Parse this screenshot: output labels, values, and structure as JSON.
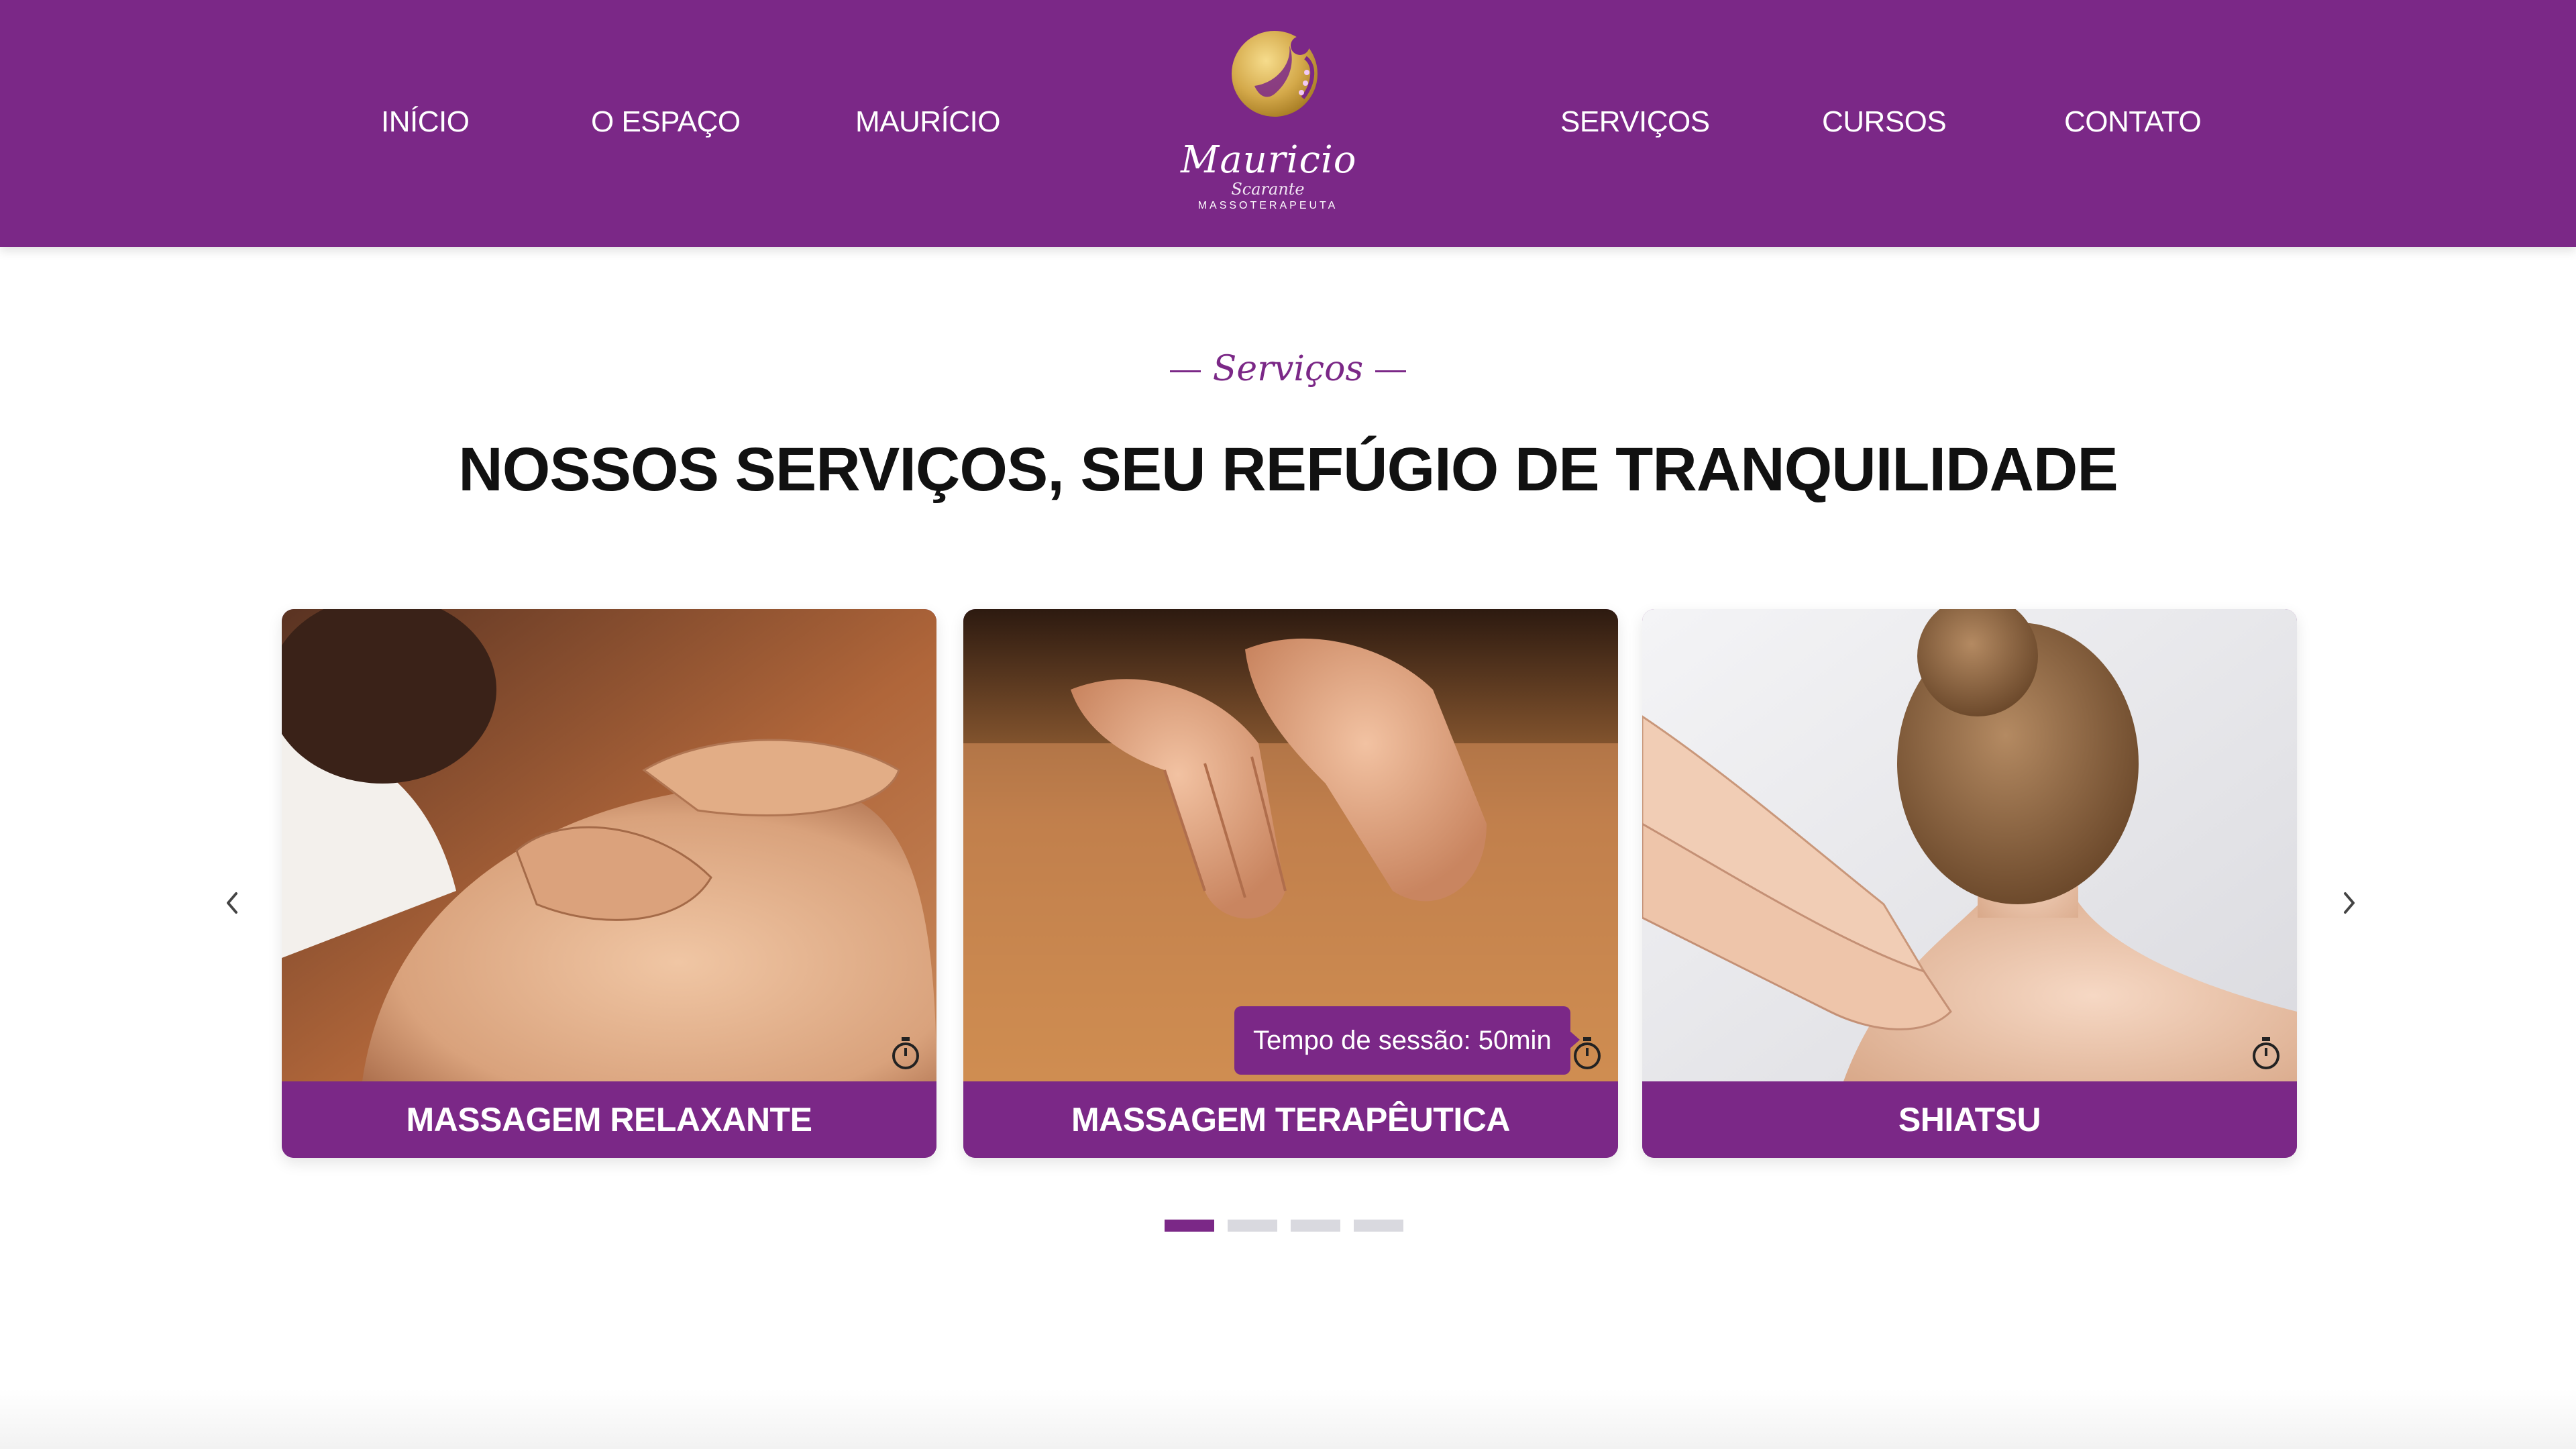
{
  "nav": {
    "items": [
      {
        "label": "INÍCIO"
      },
      {
        "label": "O ESPAÇO"
      },
      {
        "label": "MAURÍCIO"
      },
      {
        "label": "SERVIÇOS"
      },
      {
        "label": "CURSOS"
      },
      {
        "label": "CONTATO"
      }
    ]
  },
  "logo": {
    "name": "Mauricio",
    "surname": "Scarante",
    "tagline": "MASSOTERAPEUTA"
  },
  "section": {
    "eyebrow": "Serviços",
    "title": "NOSSOS SERVIÇOS, SEU REFÚGIO DE TRANQUILIDADE"
  },
  "carousel": {
    "cards": [
      {
        "label": "MASSAGEM RELAXANTE"
      },
      {
        "label": "MASSAGEM TERAPÊUTICA",
        "tooltip": "Tempo de sessão: 50min"
      },
      {
        "label": "SHIATSU"
      }
    ],
    "page_count": 4,
    "active_page": 1
  },
  "colors": {
    "brand": "#7b2887",
    "text": "#111111",
    "dot_inactive": "#d9d9df",
    "gold": "#d4a94a"
  },
  "icons": [
    "chevron-left-icon",
    "chevron-right-icon",
    "timer-icon",
    "logo-mark-icon"
  ]
}
